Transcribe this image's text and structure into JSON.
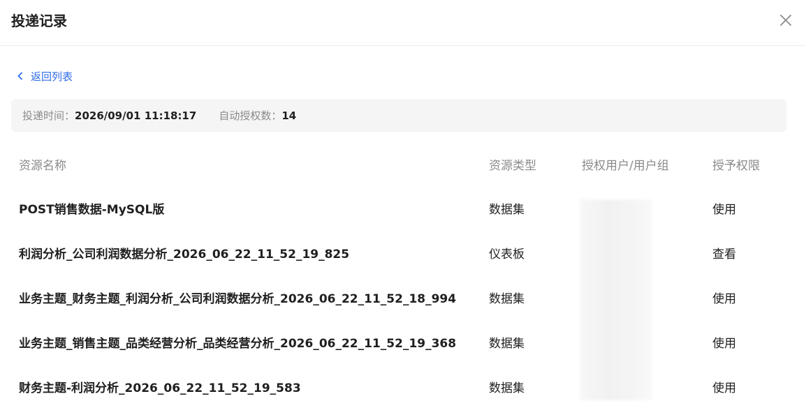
{
  "dialog": {
    "title": "投递记录"
  },
  "back": {
    "label": "返回列表"
  },
  "info": {
    "time_label": "投递时间：",
    "time_value": "2026/09/01 11:18:17",
    "count_label": "自动授权数：",
    "count_value": "14"
  },
  "table": {
    "columns": [
      "资源名称",
      "资源类型",
      "授权用户/用户组",
      "授予权限"
    ],
    "rows": [
      {
        "name": "POST销售数据-MySQL版",
        "type": "数据集",
        "users": "",
        "permission": "使用"
      },
      {
        "name": "利润分析_公司利润数据分析_2026_06_22_11_52_19_825",
        "type": "仪表板",
        "users": "",
        "permission": "查看"
      },
      {
        "name": "业务主题_财务主题_利润分析_公司利润数据分析_2026_06_22_11_52_18_994",
        "type": "数据集",
        "users": "",
        "permission": "使用"
      },
      {
        "name": "业务主题_销售主题_品类经营分析_品类经营分析_2026_06_22_11_52_19_368",
        "type": "数据集",
        "users": "",
        "permission": "使用"
      },
      {
        "name": "财务主题-利润分析_2026_06_22_11_52_19_583",
        "type": "数据集",
        "users": "",
        "permission": "使用"
      }
    ]
  },
  "icons": {
    "close": "close-icon",
    "back": "chevron-left-icon"
  },
  "colors": {
    "accent": "#2e6be6",
    "muted_text": "#8a8a8a",
    "info_bg": "#f5f5f5"
  }
}
